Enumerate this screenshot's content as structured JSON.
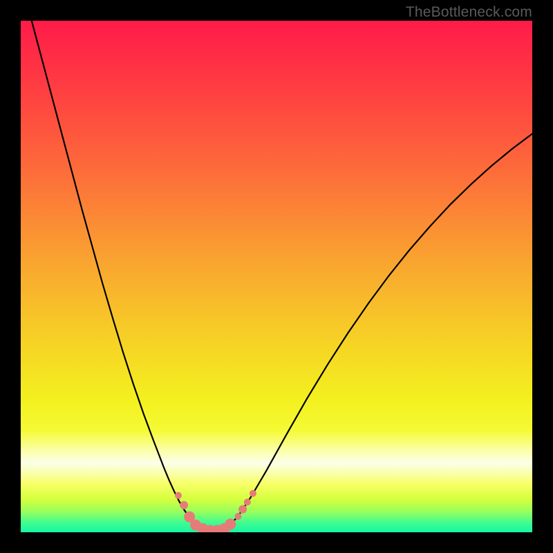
{
  "watermark": "TheBottleneck.com",
  "colors": {
    "frame": "#000000",
    "curve": "#000000",
    "markers": "#e77b78",
    "watermark": "#5a5a5a",
    "gradient_stops": [
      {
        "offset": 0.0,
        "color": "#ff1b49"
      },
      {
        "offset": 0.12,
        "color": "#ff3a42"
      },
      {
        "offset": 0.3,
        "color": "#fd6e3a"
      },
      {
        "offset": 0.48,
        "color": "#f9a72f"
      },
      {
        "offset": 0.63,
        "color": "#f6d325"
      },
      {
        "offset": 0.74,
        "color": "#f3f01f"
      },
      {
        "offset": 0.8,
        "color": "#f5fa34"
      },
      {
        "offset": 0.845,
        "color": "#fcffb6"
      },
      {
        "offset": 0.865,
        "color": "#fbffe9"
      },
      {
        "offset": 0.905,
        "color": "#f8ff68"
      },
      {
        "offset": 0.935,
        "color": "#d6ff3e"
      },
      {
        "offset": 0.96,
        "color": "#97ff5e"
      },
      {
        "offset": 0.982,
        "color": "#3efc92"
      },
      {
        "offset": 1.0,
        "color": "#16f7a3"
      }
    ]
  },
  "chart_data": {
    "type": "line",
    "title": "",
    "xlabel": "",
    "ylabel": "",
    "xlim": [
      0,
      100
    ],
    "ylim": [
      0,
      100
    ],
    "grid": false,
    "series": [
      {
        "name": "bottleneck-curve",
        "x": [
          0,
          2,
          4,
          6,
          8,
          10,
          12,
          14,
          16,
          18,
          20,
          22,
          24,
          26,
          28,
          29,
          30,
          31,
          32,
          33,
          34,
          35,
          36,
          37,
          38,
          39,
          40,
          41,
          42,
          43,
          45,
          48,
          52,
          56,
          60,
          64,
          68,
          72,
          76,
          80,
          84,
          88,
          92,
          96,
          100
        ],
        "y": [
          108,
          100.5,
          93,
          85.5,
          78,
          70.5,
          63,
          55.8,
          48.6,
          41.8,
          35.2,
          29,
          23.2,
          17.8,
          12.6,
          10.2,
          8.0,
          6.0,
          4.3,
          2.9,
          1.8,
          1.0,
          0.5,
          0.3,
          0.3,
          0.5,
          0.9,
          1.6,
          2.6,
          3.9,
          6.9,
          12.0,
          19.2,
          26.2,
          32.8,
          39.0,
          44.8,
          50.2,
          55.2,
          59.8,
          64.1,
          68.0,
          71.6,
          74.9,
          77.9
        ]
      }
    ],
    "markers": {
      "name": "highlight-points",
      "points": [
        {
          "x": 30.8,
          "y": 7.2,
          "r": 5
        },
        {
          "x": 31.9,
          "y": 5.3,
          "r": 6
        },
        {
          "x": 33.0,
          "y": 3.0,
          "r": 8
        },
        {
          "x": 34.2,
          "y": 1.4,
          "r": 8
        },
        {
          "x": 35.6,
          "y": 0.7,
          "r": 8
        },
        {
          "x": 37.0,
          "y": 0.35,
          "r": 8
        },
        {
          "x": 38.4,
          "y": 0.35,
          "r": 8
        },
        {
          "x": 39.8,
          "y": 0.7,
          "r": 8
        },
        {
          "x": 41.0,
          "y": 1.6,
          "r": 8
        },
        {
          "x": 42.5,
          "y": 3.1,
          "r": 5
        },
        {
          "x": 43.4,
          "y": 4.5,
          "r": 6
        },
        {
          "x": 44.3,
          "y": 5.9,
          "r": 5
        },
        {
          "x": 45.4,
          "y": 7.6,
          "r": 5
        }
      ]
    }
  }
}
